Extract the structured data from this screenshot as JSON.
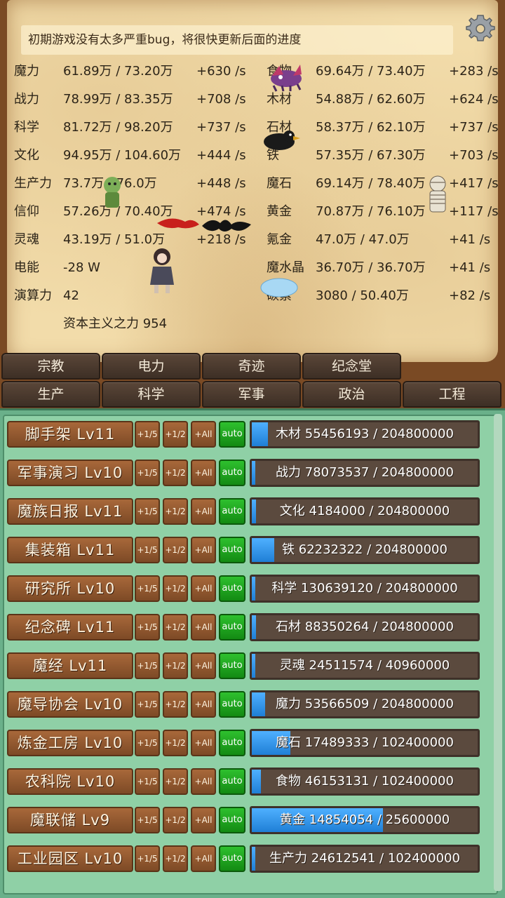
{
  "notice": "初期游戏没有太多严重bug，将很快更新后面的进度",
  "stats_left": [
    {
      "label": "魔力",
      "value": "61.89万 / 73.20万",
      "rate": "+630 /s"
    },
    {
      "label": "战力",
      "value": "78.99万 / 83.35万",
      "rate": "+708 /s"
    },
    {
      "label": "科学",
      "value": "81.72万 / 98.20万",
      "rate": "+737 /s"
    },
    {
      "label": "文化",
      "value": "94.95万 / 104.60万",
      "rate": "+444 /s"
    },
    {
      "label": "生产力",
      "value": "73.7万 / 76.0万",
      "rate": "+448 /s"
    },
    {
      "label": "信仰",
      "value": "57.26万 / 70.40万",
      "rate": "+474 /s"
    },
    {
      "label": "灵魂",
      "value": "43.19万 / 51.0万",
      "rate": "+218 /s"
    },
    {
      "label": "电能",
      "value": "-28 W",
      "rate": ""
    },
    {
      "label": "演算力",
      "value": "42",
      "rate": ""
    }
  ],
  "stats_right": [
    {
      "label": "食物",
      "value": "69.64万 / 73.40万",
      "rate": "+283 /s"
    },
    {
      "label": "木材",
      "value": "54.88万 / 62.60万",
      "rate": "+624 /s"
    },
    {
      "label": "石材",
      "value": "58.37万 / 62.10万",
      "rate": "+737 /s"
    },
    {
      "label": "铁",
      "value": "57.35万 / 67.30万",
      "rate": "+703 /s"
    },
    {
      "label": "魔石",
      "value": "69.14万 / 78.40万",
      "rate": "+417 /s"
    },
    {
      "label": "黄金",
      "value": "70.87万 / 76.10万",
      "rate": "+117 /s"
    },
    {
      "label": "氪金",
      "value": "47.0万 / 47.0万",
      "rate": "+41 /s"
    },
    {
      "label": "魔水晶",
      "value": "36.70万 / 36.70万",
      "rate": "+41 /s"
    },
    {
      "label": "碳素",
      "value": "3080 / 50.40万",
      "rate": "+82 /s"
    }
  ],
  "capitalism": "资本主义之力 954",
  "tabs_top": [
    "宗教",
    "电力",
    "奇迹",
    "纪念堂"
  ],
  "tabs_bottom": [
    "生产",
    "科学",
    "军事",
    "政治",
    "工程"
  ],
  "buttons": {
    "fifth": "+1/5",
    "half": "+1/2",
    "all": "+All",
    "auto": "auto"
  },
  "buildings": [
    {
      "name": "脚手架  Lv11",
      "progress": "木材 55456193 / 204800000",
      "fill": 0.07
    },
    {
      "name": "军事演习 Lv10",
      "progress": "战力 78073537 / 204800000",
      "fill": 0.01
    },
    {
      "name": "魔族日报 Lv11",
      "progress": "文化 4184000 / 204800000",
      "fill": 0.02
    },
    {
      "name": "集装箱  Lv11",
      "progress": "铁 62232322 / 204800000",
      "fill": 0.1
    },
    {
      "name": "研究所  Lv10",
      "progress": "科学 130639120 / 204800000",
      "fill": 0.0
    },
    {
      "name": "纪念碑  Lv11",
      "progress": "石材 88350264 / 204800000",
      "fill": 0.02
    },
    {
      "name": "魔经  Lv11",
      "progress": "灵魂 24511574 / 40960000",
      "fill": 0.0
    },
    {
      "name": "魔导协会 Lv10",
      "progress": "魔力 53566509 / 204800000",
      "fill": 0.06
    },
    {
      "name": "炼金工房 Lv10",
      "progress": "魔石 17489333 / 102400000",
      "fill": 0.17
    },
    {
      "name": "农科院  Lv10",
      "progress": "食物 46153131 / 102400000",
      "fill": 0.04
    },
    {
      "name": "魔联储  Lv9",
      "progress": "黄金 14854054 / 25600000",
      "fill": 0.58
    },
    {
      "name": "工业园区 Lv10",
      "progress": "生产力 24612541 / 102400000",
      "fill": 0.01
    }
  ],
  "colors": {
    "progress_fill": "#2f94ef",
    "auto_button": "#1fa31f",
    "panel": "#8fd0a6"
  }
}
